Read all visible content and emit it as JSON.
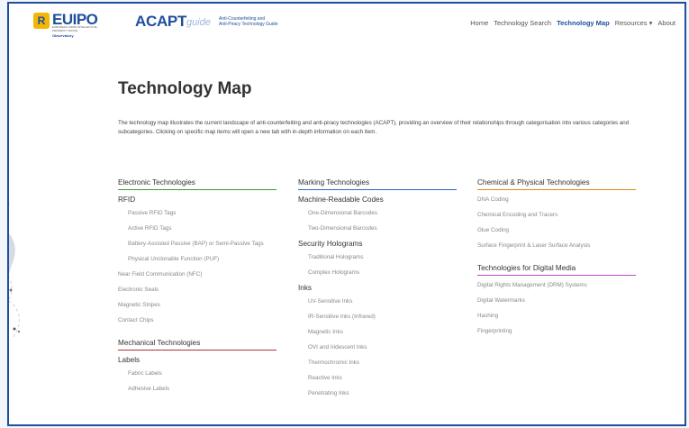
{
  "header": {
    "euipo_badge": "R",
    "euipo_name": "EUIPO",
    "euipo_sub": "EUROPEAN UNION INTELLECTUAL PROPERTY OFFICE",
    "euipo_obs": "Observatory",
    "acapt": "ACAPT",
    "guide": "guide",
    "tagline_1": "Anti-Counterfeiting and",
    "tagline_2": "Anti-Piracy Technology Guide"
  },
  "nav": {
    "home": "Home",
    "technology_search": "Technology Search",
    "technology_map": "Technology Map",
    "resources": "Resources ▾",
    "about": "About"
  },
  "main": {
    "title": "Technology Map",
    "intro": "The technology map illustrates the current landscape of anti-counterfeiting and anti-piracy technologies (ACAPT), providing an overview of their relationships through categorisation into various categories and subcategories. Clicking on specific map items will open a new tab with in-depth information on each item."
  },
  "col1": {
    "electronic": "Electronic Technologies",
    "rfid": "RFID",
    "rfid_items": [
      "Passive RFID Tags",
      "Active RFID Tags",
      "Battery-Assisted Passive (BAP) or Semi-Passive Tags",
      "Physical Unclonable Function (PUF)"
    ],
    "other_items": [
      "Near Field Communication (NFC)",
      "Electronic Seals",
      "Magnetic Stripes",
      "Contact Chips"
    ],
    "mechanical": "Mechanical Technologies",
    "labels": "Labels",
    "label_items": [
      "Fabric Labels",
      "Adhesive Labels"
    ]
  },
  "col2": {
    "marking": "Marking Technologies",
    "machine": "Machine-Readable Codes",
    "machine_items": [
      "One-Dimensional Barcodes",
      "Two-Dimensional Barcodes"
    ],
    "holograms": "Security Holograms",
    "hologram_items": [
      "Traditional Holograms",
      "Complex Holograms"
    ],
    "inks": "Inks",
    "ink_items": [
      "UV-Sensitive Inks",
      "IR-Sensitive Inks (Infrared)",
      "Magnetic Inks",
      "OVI and Iridescent Inks",
      "Thermochromic Inks",
      "Reactive Inks",
      "Penetrating Inks"
    ]
  },
  "col3": {
    "chemical": "Chemical & Physical Technologies",
    "chemical_items": [
      "DNA Coding",
      "Chemical Encoding and Tracers",
      "Glue Coding",
      "Surface Fingerprint & Laser Surface Analysis"
    ],
    "digital": "Technologies for Digital Media",
    "digital_items": [
      "Digital Rights Management (DRM) Systems",
      "Digital Watermarks",
      "Hashing",
      "Fingerprinting"
    ]
  },
  "colors": {
    "brand_blue": "#1f4e9c",
    "electronic": "#3a9a3a",
    "marking": "#2c68c8",
    "chemical": "#e38a1a",
    "mechanical": "#b23333",
    "digital": "#b848c8"
  }
}
